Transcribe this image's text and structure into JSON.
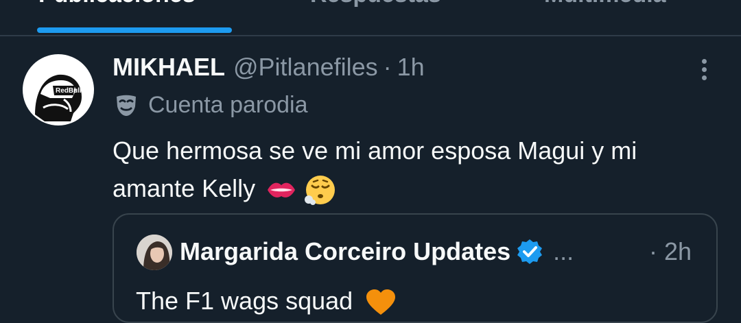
{
  "tabs": [
    {
      "label": "Publicaciones",
      "active": true
    },
    {
      "label": "Respuestas",
      "active": false
    },
    {
      "label": "Multimedia",
      "active": false
    }
  ],
  "colors": {
    "background": "#15202b",
    "accent": "#1d9bf0",
    "muted": "#8b98a5",
    "text": "#f7f9f9",
    "border": "#38444d"
  },
  "tweet": {
    "author_name": "MIKHAEL",
    "handle": "@Pitlanefiles",
    "separator": "·",
    "time": "1h",
    "parody_icon": "mask-icon",
    "parody_label": "Cuenta parodia",
    "text": "Que hermosa se ve mi amor esposa Magui y mi amante Kelly",
    "emojis": [
      "lips-emoji",
      "face-exhaling-emoji"
    ],
    "more_icon": "more-vertical-icon"
  },
  "quote": {
    "author_name": "Margarida Corceiro Updates",
    "verified_icon": "verified-badge-icon",
    "ellipsis": "...",
    "time": "· 2h",
    "text": "The F1 wags squad",
    "emoji": "orange-heart-emoji"
  }
}
